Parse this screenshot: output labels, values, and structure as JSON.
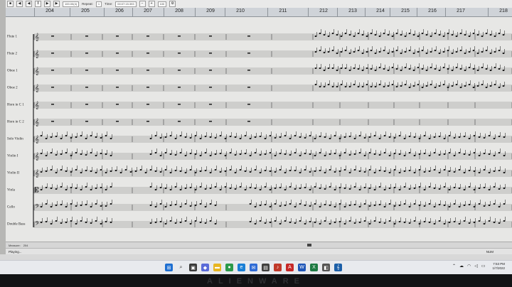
{
  "toolbar": {
    "tempo_field": "100.00(4)",
    "repeat_label": "Repeat:",
    "repeat_value": "1",
    "time_label": "Time:",
    "time_value": "00:07:15.393",
    "zoom_value": "100"
  },
  "ruler": {
    "measures": [
      "204",
      "205",
      "206",
      "207",
      "208",
      "209",
      "210",
      "211",
      "212",
      "213",
      "214",
      "215",
      "216",
      "217",
      "218"
    ]
  },
  "instruments": [
    "Flute 1",
    "Flute 2",
    "Oboe 1",
    "Oboe 2",
    "Horn in C 1",
    "Horn in C 2",
    "Solo Violin",
    "Violin I",
    "Violin II",
    "Viola",
    "Cello",
    "Double Bass"
  ],
  "hscroll": {
    "measure_label": "Measure:",
    "measure_value": "204"
  },
  "status": {
    "left": "Playing...",
    "right": "NUM"
  },
  "taskbar": {
    "icons": [
      "windows-start",
      "search",
      "file-explorer",
      "settings",
      "media",
      "chrome",
      "edge",
      "mail",
      "store",
      "music",
      "pdf",
      "word",
      "excel",
      "app",
      "notation"
    ],
    "time": "7:53 PM",
    "date": "1/7/2022"
  },
  "bezel": {
    "brand": "ALIENWARE"
  },
  "colors": {
    "ruler": "#cfd3d8",
    "score_bg": "#e7e7e5",
    "taskbar": "#e8eaee",
    "bezel": "#121315"
  }
}
